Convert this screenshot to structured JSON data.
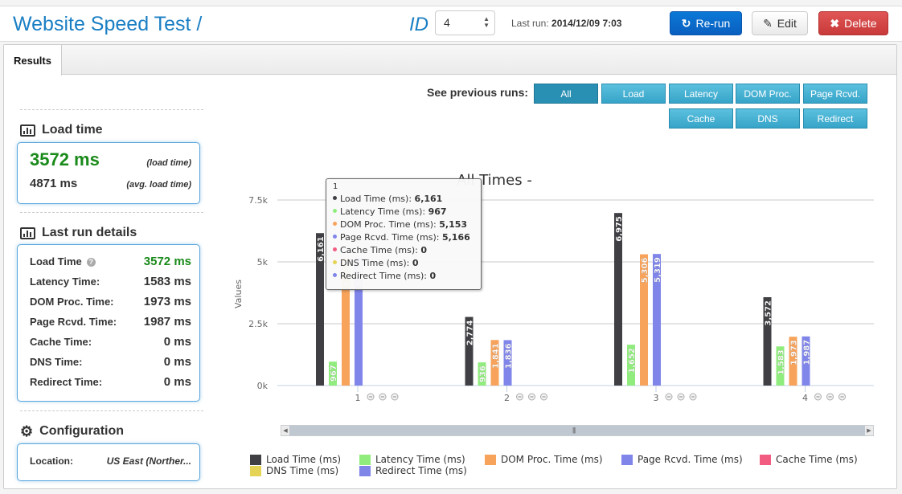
{
  "header": {
    "title": "Website Speed Test /",
    "id_label": "ID",
    "id_value": "4",
    "last_run_label": "Last run:",
    "last_run_value": "2014/12/09 7:03",
    "rerun_label": "Re-run",
    "edit_label": "Edit",
    "delete_label": "Delete"
  },
  "tabs": [
    {
      "label": "Results",
      "active": true
    }
  ],
  "load_time": {
    "title": "Load time",
    "value": "3572 ms",
    "value_caption": "(load time)",
    "avg": "4871 ms",
    "avg_caption": "(avg. load time)"
  },
  "last_run_details": {
    "title": "Last run details",
    "rows": [
      {
        "label": "Load Time",
        "value": "3572 ms"
      },
      {
        "label": "Latency Time:",
        "value": "1583 ms"
      },
      {
        "label": "DOM Proc. Time:",
        "value": "1973 ms"
      },
      {
        "label": "Page Rcvd. Time:",
        "value": "1987 ms"
      },
      {
        "label": "Cache Time:",
        "value": "0 ms"
      },
      {
        "label": "DNS Time:",
        "value": "0 ms"
      },
      {
        "label": "Redirect Time:",
        "value": "0 ms"
      }
    ]
  },
  "configuration": {
    "title": "Configuration",
    "location_label": "Location:",
    "location_value": "US East (Norther..."
  },
  "filters": {
    "label": "See previous runs:",
    "buttons": [
      "All",
      "Load",
      "Latency",
      "DOM Proc.",
      "Page Rcvd.",
      "Cache",
      "DNS",
      "Redirect"
    ],
    "active": "All"
  },
  "tooltip": {
    "header": "1",
    "rows": [
      {
        "label": "Load Time (ms): ",
        "value": "6,161"
      },
      {
        "label": "Latency Time (ms): ",
        "value": "967"
      },
      {
        "label": "DOM Proc. Time (ms): ",
        "value": "5,153"
      },
      {
        "label": "Page Rcvd. Time (ms): ",
        "value": "5,166"
      },
      {
        "label": "Cache Time (ms): ",
        "value": "0"
      },
      {
        "label": "DNS Time (ms): ",
        "value": "0"
      },
      {
        "label": "Redirect Time (ms): ",
        "value": "0"
      }
    ]
  },
  "chart_data": {
    "type": "bar",
    "title": "All Times -",
    "xlabel": "",
    "ylabel": "Values",
    "ylim": [
      0,
      7500
    ],
    "yticks": [
      "0k",
      "2.5k",
      "5k",
      "7.5k"
    ],
    "ytick_values": [
      0,
      2500,
      5000,
      7500
    ],
    "categories": [
      "1",
      "2",
      "3",
      "4"
    ],
    "grid": true,
    "legend_position": "bottom",
    "series": [
      {
        "name": "Load Time (ms)",
        "color": "#3f3f44",
        "values": [
          6161,
          2774,
          6975,
          3572
        ]
      },
      {
        "name": "Latency Time (ms)",
        "color": "#90ed7d",
        "values": [
          967,
          936,
          1652,
          1583
        ]
      },
      {
        "name": "DOM Proc. Time (ms)",
        "color": "#f7a35c",
        "values": [
          5153,
          1841,
          5306,
          1973
        ]
      },
      {
        "name": "Page Rcvd. Time (ms)",
        "color": "#8085e9",
        "values": [
          5166,
          1836,
          5319,
          1987
        ]
      },
      {
        "name": "Cache Time (ms)",
        "color": "#f15c80",
        "values": [
          0,
          0,
          0,
          0
        ]
      },
      {
        "name": "DNS Time (ms)",
        "color": "#e4d354",
        "values": [
          0,
          0,
          0,
          0
        ]
      },
      {
        "name": "Redirect Time (ms)",
        "color": "#8085e8",
        "values": [
          0,
          0,
          0,
          0
        ]
      }
    ]
  }
}
